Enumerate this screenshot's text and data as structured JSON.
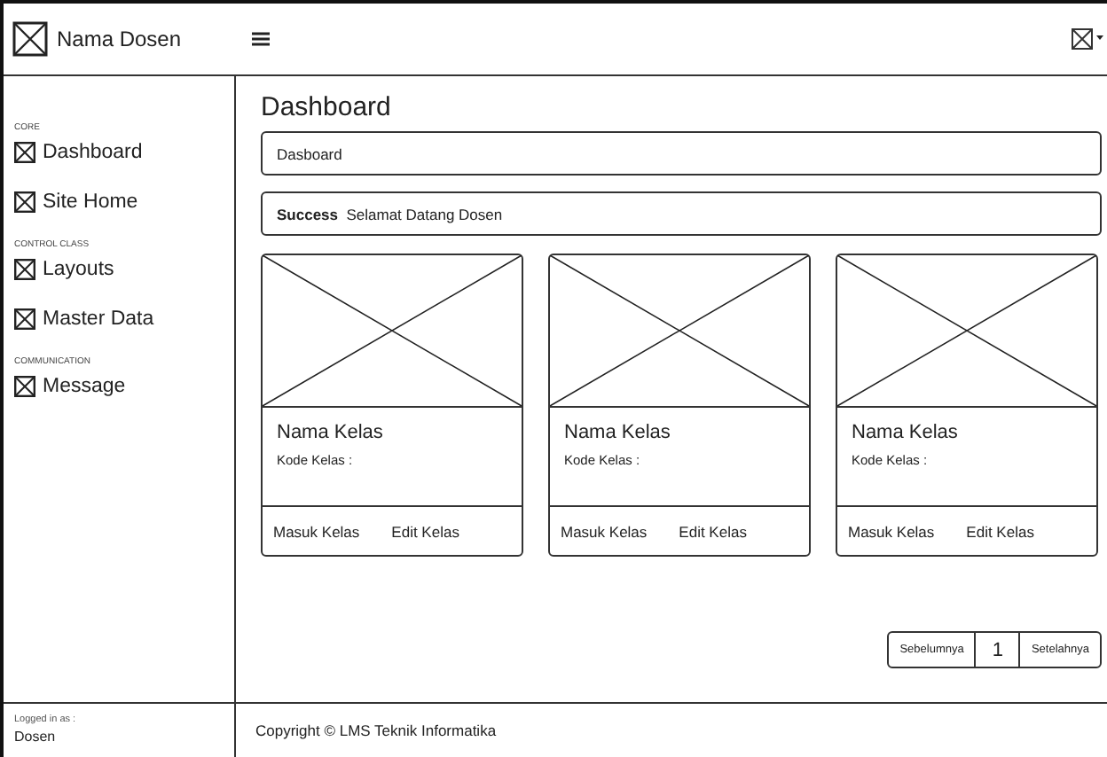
{
  "topbar": {
    "brand": "Nama Dosen"
  },
  "sidebar": {
    "sections": [
      {
        "heading": "CORE",
        "items": [
          {
            "label": "Dashboard"
          },
          {
            "label": "Site Home"
          }
        ]
      },
      {
        "heading": "CONTROL CLASS",
        "items": [
          {
            "label": "Layouts"
          },
          {
            "label": "Master Data"
          }
        ]
      },
      {
        "heading": "COMMUNICATION",
        "items": [
          {
            "label": "Message"
          }
        ]
      }
    ],
    "footer": {
      "caption": "Logged in as :",
      "user": "Dosen"
    }
  },
  "main": {
    "title": "Dashboard",
    "breadcrumb": "Dasboard",
    "alert": {
      "label": "Success",
      "message": "Selamat Datang Dosen"
    },
    "cards": [
      {
        "name": "Nama Kelas",
        "code": "Kode Kelas :",
        "actions": [
          "Masuk Kelas",
          "Edit Kelas"
        ]
      },
      {
        "name": "Nama Kelas",
        "code": "Kode Kelas :",
        "actions": [
          "Masuk Kelas",
          "Edit Kelas"
        ]
      },
      {
        "name": "Nama Kelas",
        "code": "Kode Kelas :",
        "actions": [
          "Masuk Kelas",
          "Edit Kelas"
        ]
      }
    ],
    "pagination": {
      "previous": "Sebelumnya",
      "page": "1",
      "next": "Setelahnya"
    }
  },
  "footer": {
    "copyright": "Copyright © LMS Teknik Informatika"
  }
}
